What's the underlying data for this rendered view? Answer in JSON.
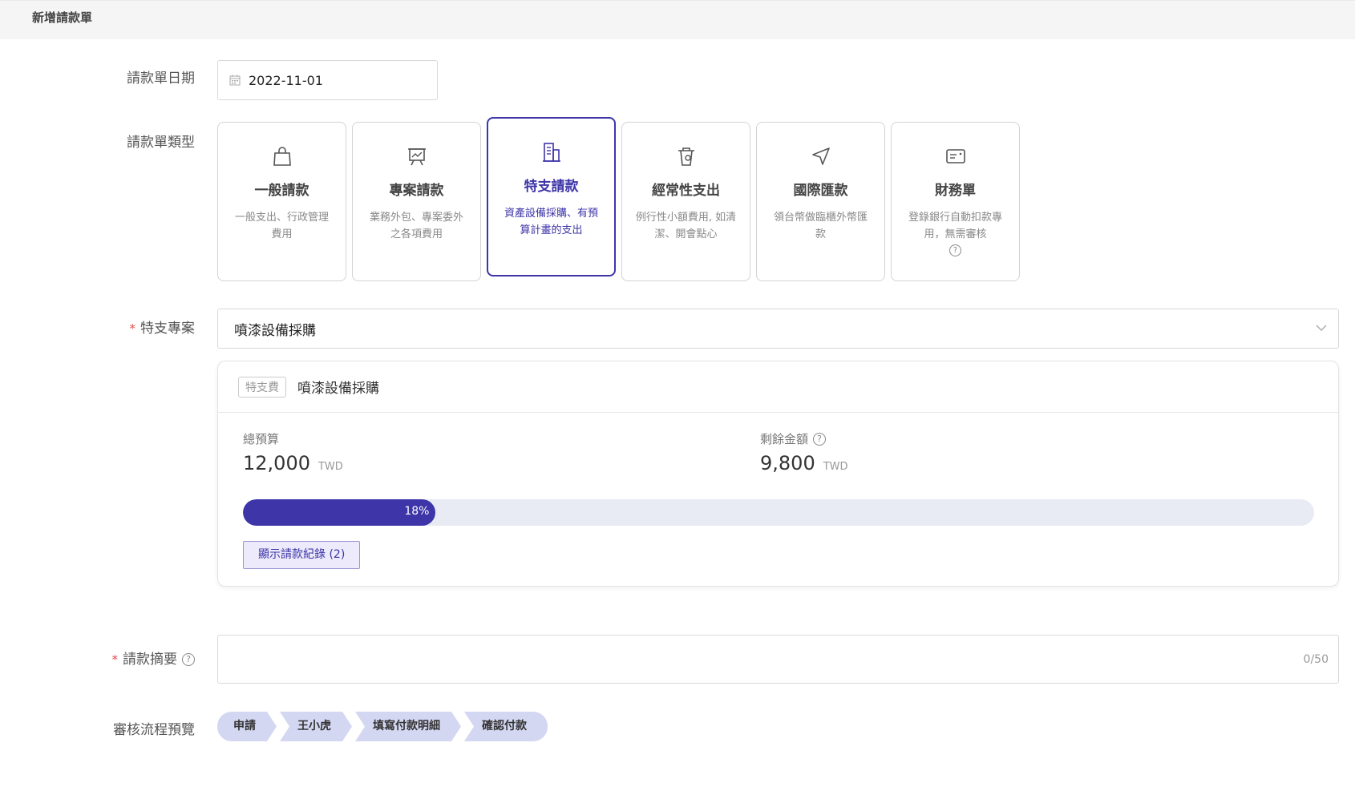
{
  "header": {
    "title": "新增請款單"
  },
  "form": {
    "date_label": "請款單日期",
    "date_value": "2022-11-01",
    "type_label": "請款單類型",
    "project_label": "特支專案",
    "summary_label": "請款摘要",
    "flow_label": "審核流程預覽"
  },
  "types": [
    {
      "name": "一般請款",
      "desc": "一般支出、行政管理費用",
      "icon": "shopping-bag-icon"
    },
    {
      "name": "專案請款",
      "desc": "業務外包、專案委外之各項費用",
      "icon": "presentation-board-icon"
    },
    {
      "name": "特支請款",
      "desc": "資產設備採購、有預算計畫的支出",
      "icon": "building-icon",
      "selected": true
    },
    {
      "name": "經常性支出",
      "desc": "例行性小額費用, 如清潔、開會點心",
      "icon": "cup-icon"
    },
    {
      "name": "國際匯款",
      "desc": "領台幣做臨櫃外幣匯款",
      "icon": "send-arrow-icon"
    },
    {
      "name": "財務單",
      "desc": "登錄銀行自動扣款專用，無需審核",
      "icon": "card-icon",
      "help": true
    }
  ],
  "project": {
    "selected": "噴漆設備採購",
    "tag": "特支費",
    "name": "噴漆設備採購",
    "total_label": "總預算",
    "total_value": "12,000",
    "remaining_label": "剩餘金額",
    "remaining_value": "9,800",
    "unit": "TWD",
    "progress_percent": 18,
    "progress_text": "18%",
    "record_button": "顯示請款紀錄 (2)"
  },
  "summary": {
    "counter": "0/50"
  },
  "flow_steps": [
    "申請",
    "王小虎",
    "填寫付款明細",
    "確認付款"
  ],
  "colors": {
    "accent": "#3d35a8",
    "step_bg": "#d4d7f2",
    "required": "#e04a4a"
  }
}
